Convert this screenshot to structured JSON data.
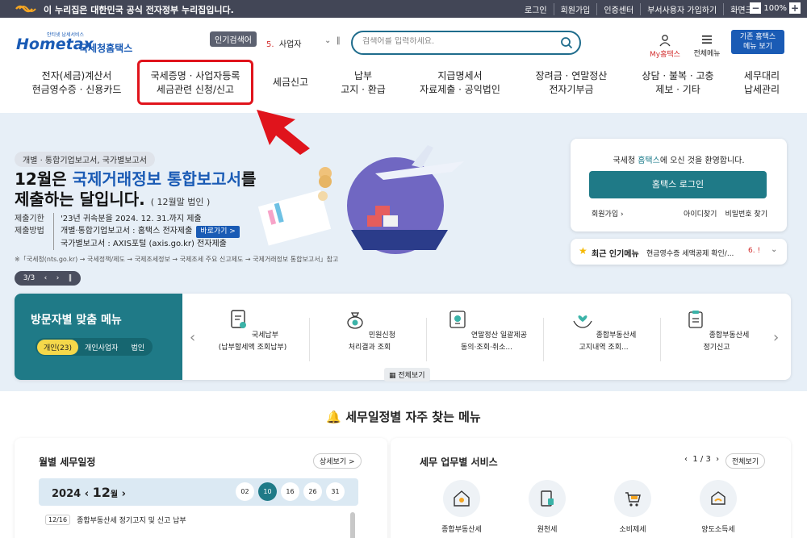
{
  "gov_bar": {
    "text": "이 누리집은 대한민국 공식 전자정부 누리집입니다.",
    "links": [
      "로그인",
      "회원가입",
      "인증센터",
      "부서사용자 가입하기",
      "화면크기"
    ],
    "zoom": "100%"
  },
  "header": {
    "logo_small": "안티넷 납세서비스",
    "logo_brand": "Hometax",
    "logo_kr": "국세청홈택스",
    "popular_label": "인기검색어",
    "popular_rank": "5.",
    "popular_term": "사업자",
    "search_placeholder": "검색어를 입력하세요.",
    "my_hometax": "My홈택스",
    "all_menu": "전체메뉴",
    "old_menu_line1": "기존 홈택스",
    "old_menu_line2": "메뉴 보기"
  },
  "nav": [
    {
      "l1": "전자(세금)계산서",
      "l2": "현금영수증 · 신용카드"
    },
    {
      "l1": "국세증명 · 사업자등록",
      "l2": "세금관련 신청/신고"
    },
    {
      "l1": "세금신고",
      "l2": ""
    },
    {
      "l1": "납부",
      "l2": "고지 · 환급"
    },
    {
      "l1": "지급명세서",
      "l2": "자료제출 · 공익법인"
    },
    {
      "l1": "장려금 · 연말정산",
      "l2": "전자기부금"
    },
    {
      "l1": "상담 · 불복 · 고충",
      "l2": "제보 · 기타"
    },
    {
      "l1": "세무대리",
      "l2": "납세관리"
    }
  ],
  "hero": {
    "tag": "개별 · 통합기업보고서, 국가별보고서",
    "title_a": "12월은 ",
    "title_blue": "국제거래정보 통합보고서",
    "title_b": "를",
    "title_line2": "제출하는 달입니다.",
    "title_note": "( 12월말 법인 )",
    "deadline_key": "제출기한",
    "deadline_val": "'23년 귀속분을 2024. 12. 31.까지 제출",
    "method_key": "제출방법",
    "method_val1": "개별·통합기업보고서 : 홈택스 전자제출",
    "go_btn": "바로가기 >",
    "method_val2": "국가별보고서 : AXIS포털 (axis.go.kr) 전자제출",
    "note": "※「국세청(nts.go.kr) → 국세정책/제도 → 국제조세정보 → 국제조세 주요 신고제도 → 국제거래정보 통합보고서」참고",
    "pager": "3/3"
  },
  "login": {
    "welcome_a": "국세청 ",
    "welcome_b": "홈택스",
    "welcome_c": "에 오신 것을 환영합니다.",
    "button": "홈택스 로그인",
    "join": "회원가입",
    "find_id": "아이디찾기",
    "find_pw": "비밀번호 찾기"
  },
  "popular_card": {
    "label": "최근 인기메뉴",
    "text": "현금영수증 세액공제 확인/...",
    "num": "6. !"
  },
  "visitor": {
    "title": "방문자별 맞춤 메뉴",
    "tabs": [
      "개인(23)",
      "개인사업자",
      "법인"
    ],
    "items": [
      {
        "l1": "국세납부",
        "l2": "(납부할세액 조회납부)"
      },
      {
        "l1": "민원신청",
        "l2": "처리결과 조회"
      },
      {
        "l1": "연말정산 일괄제공",
        "l2": "동의·조회·취소..."
      },
      {
        "l1": "종합부동산세",
        "l2": "고지내역 조회..."
      },
      {
        "l1": "종합부동산세",
        "l2": "정기신고"
      }
    ],
    "view_all": "전체보기"
  },
  "section": {
    "title": "세무일정별 자주 찾는 메뉴"
  },
  "calendar": {
    "title": "월별 세무일정",
    "detail": "상세보기 >",
    "year": "2024",
    "month": "12",
    "month_suffix": "월",
    "days": [
      "02",
      "10",
      "16",
      "26",
      "31"
    ],
    "schedule_date": "12/16",
    "schedule_text": "종합부동산세 정기고지 및 신고 납부"
  },
  "services": {
    "title": "세무 업무별 서비스",
    "pager": "1 / 3",
    "view_all": "전체보기",
    "items": [
      "종합부동산세",
      "원천세",
      "소비제세",
      "양도소득세"
    ]
  },
  "colors": {
    "brand_blue": "#1a5bb5",
    "teal": "#1f7a87",
    "highlight_red": "#e0141c"
  }
}
